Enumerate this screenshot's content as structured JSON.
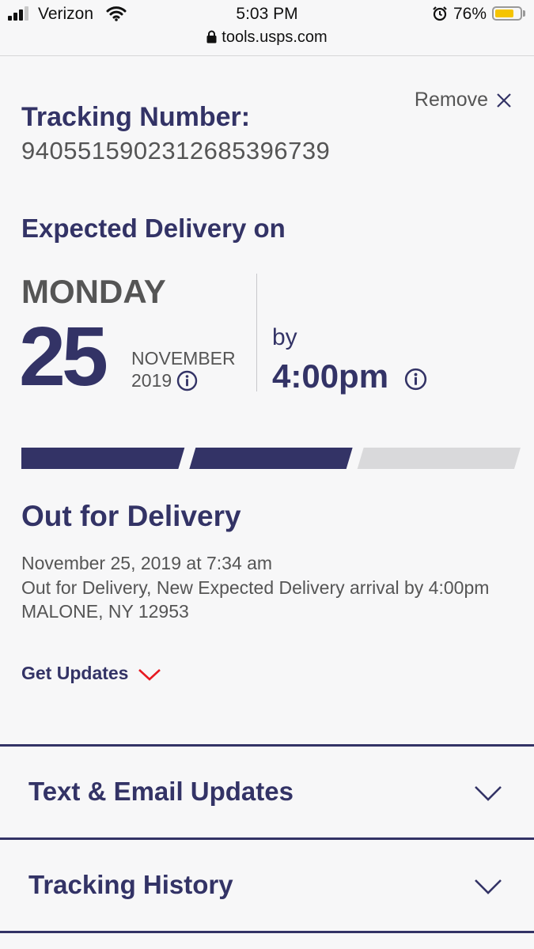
{
  "status_bar": {
    "carrier": "Verizon",
    "time": "5:03 PM",
    "battery_percent": "76%",
    "battery_level": 0.76,
    "url": "tools.usps.com"
  },
  "tracking": {
    "label": "Tracking Number:",
    "number": "9405515902312685396739",
    "remove_label": "Remove"
  },
  "delivery": {
    "heading": "Expected Delivery on",
    "day_name": "MONDAY",
    "day_number": "25",
    "month": "NOVEMBER",
    "year": "2019",
    "by_label": "by",
    "by_time": "4:00pm"
  },
  "progress": {
    "completed_steps": 2,
    "total_steps": 3
  },
  "status": {
    "heading": "Out for Delivery",
    "lines": [
      "November 25, 2019 at 7:34 am",
      "Out for Delivery, New Expected Delivery arrival by 4:00pm",
      "MALONE, NY 12953"
    ],
    "get_updates_label": "Get Updates"
  },
  "sections": [
    {
      "label": "Text & Email Updates"
    },
    {
      "label": "Tracking History"
    }
  ],
  "colors": {
    "brand": "#333366",
    "accent_red": "#e71921",
    "progress_inactive": "#d9d9db"
  }
}
